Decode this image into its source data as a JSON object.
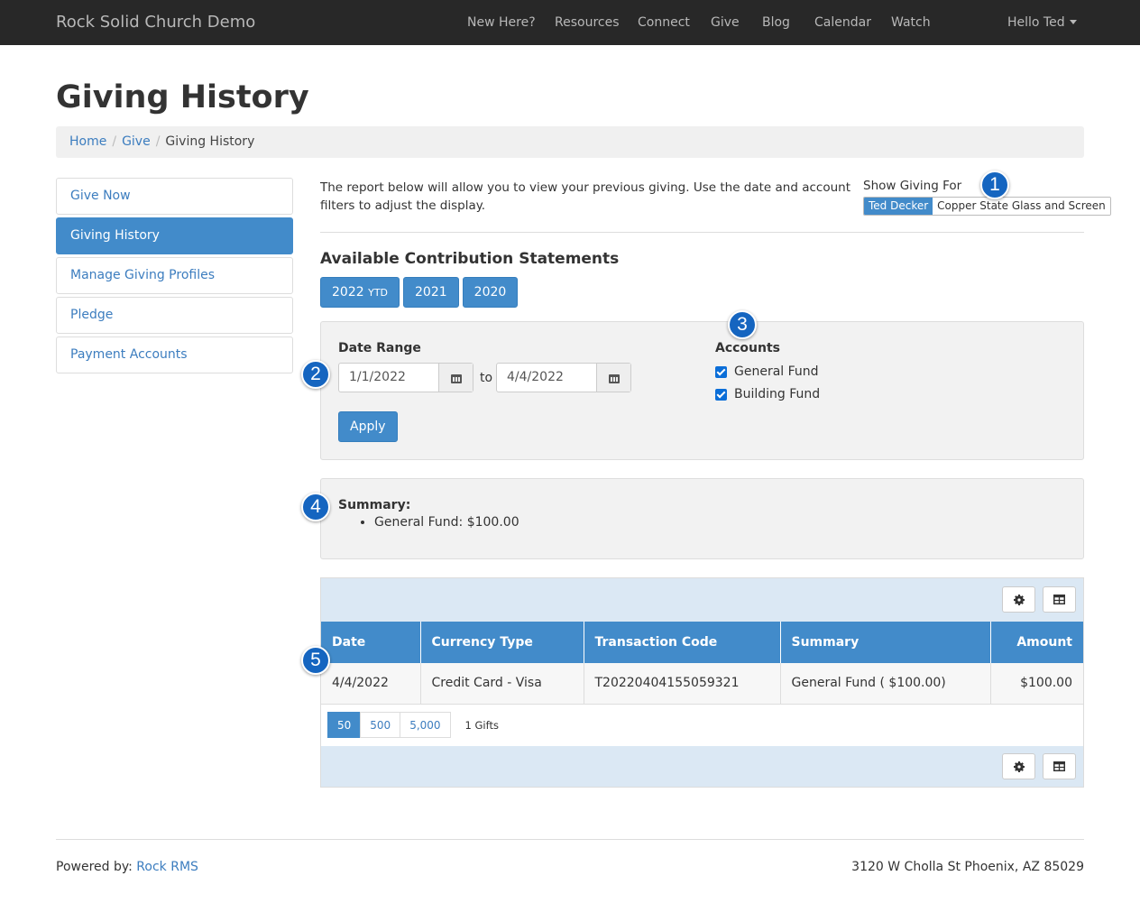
{
  "navbar": {
    "brand": "Rock Solid Church Demo",
    "items": [
      "New Here?",
      "Resources",
      "Connect",
      "Give",
      "Blog",
      "Calendar",
      "Watch"
    ],
    "user_menu": "Hello Ted"
  },
  "page": {
    "title": "Giving History"
  },
  "breadcrumb": {
    "items": [
      "Home",
      "Give"
    ],
    "current": "Giving History"
  },
  "sidebar": {
    "items": [
      {
        "label": "Give Now"
      },
      {
        "label": "Giving History"
      },
      {
        "label": "Manage Giving Profiles"
      },
      {
        "label": "Pledge"
      },
      {
        "label": "Payment Accounts"
      }
    ]
  },
  "intro": {
    "text": "The report below will allow you to view your previous giving. Use the date and account filters to adjust the display.",
    "show_giving_for_label": "Show Giving For",
    "options": [
      "Ted Decker",
      "Copper State Glass and Screen"
    ]
  },
  "statements": {
    "title": "Available Contribution Statements",
    "buttons": [
      {
        "year": "2022",
        "suffix": "YTD"
      },
      {
        "year": "2021",
        "suffix": ""
      },
      {
        "year": "2020",
        "suffix": ""
      }
    ]
  },
  "filters": {
    "date_range_label": "Date Range",
    "start_date": "1/1/2022",
    "to_label": "to",
    "end_date": "4/4/2022",
    "apply_label": "Apply",
    "accounts_label": "Accounts",
    "accounts": [
      "General Fund",
      "Building Fund"
    ]
  },
  "summary": {
    "title": "Summary:",
    "items": [
      "General Fund: $100.00"
    ]
  },
  "grid": {
    "columns": [
      "Date",
      "Currency Type",
      "Transaction Code",
      "Summary",
      "Amount"
    ],
    "rows": [
      {
        "date": "4/4/2022",
        "currency_type": "Credit Card - Visa",
        "transaction_code": "T20220404155059321",
        "summary": "General Fund ( $100.00)",
        "amount": "$100.00"
      }
    ],
    "page_sizes": [
      "50",
      "500",
      "5,000"
    ],
    "count_label": "1 Gifts"
  },
  "callouts": [
    "1",
    "2",
    "3",
    "4",
    "5"
  ],
  "footer": {
    "powered_by_label": "Powered by:",
    "powered_by_link": "Rock RMS",
    "address": "3120 W Cholla St Phoenix, AZ 85029"
  },
  "colors": {
    "primary": "#428bca",
    "navbar": "#282828",
    "callout": "#1565c0"
  }
}
